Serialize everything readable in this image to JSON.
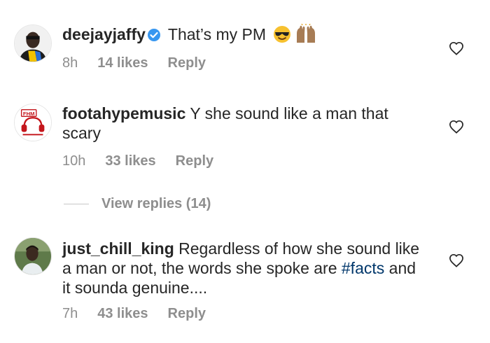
{
  "comments": [
    {
      "username": "deejayjaffy",
      "verified": true,
      "text": "That’s my PM",
      "emojis": [
        "smiling-face-with-sunglasses",
        "raising-hands"
      ],
      "time": "8h",
      "likes": "14 likes",
      "reply": "Reply"
    },
    {
      "username": "footahypemusic",
      "verified": false,
      "avatar_text": "FHM",
      "text": "Y she sound like a man that scary",
      "time": "10h",
      "likes": "33 likes",
      "reply": "Reply"
    },
    {
      "username": "just_chill_king",
      "verified": false,
      "text_before": "Regardless of how she sound like a man or not, the words she spoke are ",
      "hashtag": "#facts",
      "text_after": " and it sounda genuine....",
      "time": "7h",
      "likes": "43 likes",
      "reply": "Reply"
    }
  ],
  "view_replies": "View replies (14)",
  "colors": {
    "text": "#262626",
    "muted": "#8e8e8e",
    "hashtag": "#00376b",
    "verified": "#3897f0"
  }
}
